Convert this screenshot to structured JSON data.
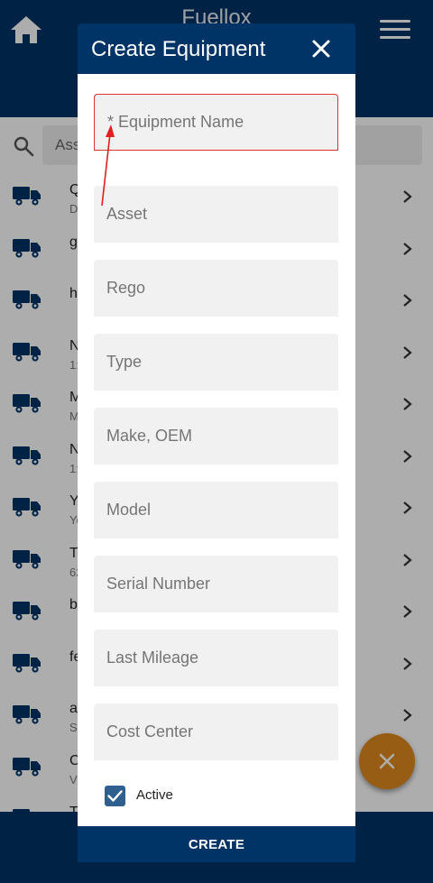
{
  "app": {
    "title": "Fuellox"
  },
  "search": {
    "value": "Ass"
  },
  "list": [
    {
      "title": "Q",
      "subtitle": "D"
    },
    {
      "title": "g",
      "subtitle": ""
    },
    {
      "title": "h",
      "subtitle": ""
    },
    {
      "title": "N",
      "subtitle": "1:"
    },
    {
      "title": "M",
      "subtitle": "M"
    },
    {
      "title": "N",
      "subtitle": "1:"
    },
    {
      "title": "Y",
      "subtitle": "Yo"
    },
    {
      "title": "T",
      "subtitle": "62"
    },
    {
      "title": "b",
      "subtitle": ""
    },
    {
      "title": "fe",
      "subtitle": ""
    },
    {
      "title": "a",
      "subtitle": "S"
    },
    {
      "title": "C",
      "subtitle": "V"
    },
    {
      "title": "T",
      "subtitle": ""
    }
  ],
  "modal": {
    "title": "Create Equipment",
    "fields": {
      "equipment_name": "* Equipment Name",
      "asset": "Asset",
      "rego": "Rego",
      "type": "Type",
      "make": "Make, OEM",
      "model": "Model",
      "serial": "Serial Number",
      "mileage": "Last Mileage",
      "cost_center": "Cost Center"
    },
    "active_label": "Active",
    "active_checked": true,
    "create_label": "CREATE"
  },
  "colors": {
    "primary": "#003366",
    "accent": "#e08a1e",
    "highlight": "#dd3333"
  },
  "icons": [
    "home-icon",
    "menu-icon",
    "search-icon",
    "truck-icon",
    "chevron-right-icon",
    "close-icon",
    "check-icon"
  ]
}
